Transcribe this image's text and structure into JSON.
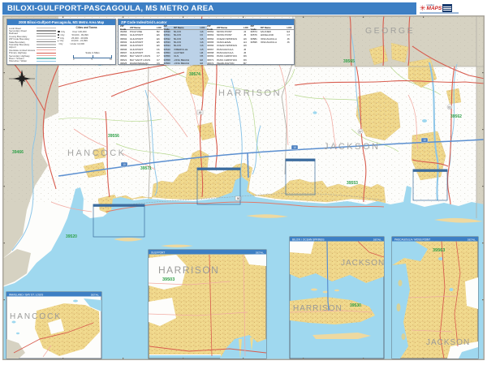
{
  "title_bar": {
    "title": "BILOXI-GULFPORT-PASCAGOULA, MS METRO AREA"
  },
  "logo": {
    "glyph": "✳",
    "name_top": "market",
    "name_main": "MAPS"
  },
  "colors": {
    "accent_blue": "#3d7fc4",
    "outside_area": "#d6d2c2",
    "metro_white": "#fdfdfb",
    "urban": "#f1da8e",
    "water": "#9fd8ef",
    "road_red": "#d85c4e",
    "zip_green": "#2fa048",
    "county_gray": "#9b9b99",
    "table_highlight": "#bcd2e8"
  },
  "legend": {
    "header": "2008 Biloxi-Gulfport-Pascagoula, MS Metro Area Map",
    "columns_title": "Cities and Towns",
    "items": [
      {
        "label": "Local Road",
        "color": "#b9b9b9"
      },
      {
        "label": "Secondary Road",
        "color": "#9a9a9a"
      },
      {
        "label": "Railroad",
        "color": "#8a8a8a"
      },
      {
        "label": "County Boundary",
        "color": "#9a9a9a"
      },
      {
        "label": "ZIP Code Boundary",
        "color": "#c0c0c0"
      },
      {
        "label": "State Boundary",
        "color": "#8a8a8a"
      },
      {
        "label": "Township Boundary",
        "color": "#c7c7c7"
      },
      {
        "label": "Airport",
        "color": "#a5a5a5"
      },
      {
        "label": "Interstate Limited Access",
        "color": "#f2aca4"
      },
      {
        "label": "Primary Highway",
        "color": "#d85c4e"
      },
      {
        "label": "Secondary Highway",
        "color": "#f2aca4"
      },
      {
        "label": "River / Stream",
        "color": "#7fc9c0"
      },
      {
        "label": "Shoreline / Water",
        "color": "#8ec6e8"
      }
    ],
    "city_rows": [
      {
        "city": "City",
        "range": "Over 100,000"
      },
      {
        "city": "City",
        "range": "50,000 - 99,999"
      },
      {
        "city": "City",
        "range": "25,000 - 49,999"
      },
      {
        "city": "City",
        "range": "10,000 - 24,999"
      },
      {
        "city": "City",
        "range": "Under 10,000"
      }
    ],
    "scale_title": "Scale in Miles",
    "scale_ticks": [
      "0",
      "5",
      "10"
    ]
  },
  "zip_table": {
    "header": "ZIP Code Index/Grid Locator",
    "col_headers": [
      "ZIP Code",
      "ZIP Name",
      "LOC"
    ],
    "columns": [
      [
        {
          "zip": "39466",
          "name": "PICAYUNE",
          "loc": "B2"
        },
        {
          "zip": "39501",
          "name": "GULFPORT",
          "loc": "E6"
        },
        {
          "zip": "39502",
          "name": "GULFPORT",
          "loc": "E6"
        },
        {
          "zip": "39503",
          "name": "GULFPORT",
          "loc": "E5"
        },
        {
          "zip": "39505",
          "name": "GULFPORT",
          "loc": "E6"
        },
        {
          "zip": "39506",
          "name": "GULFPORT",
          "loc": "F6"
        },
        {
          "zip": "39507",
          "name": "GULFPORT",
          "loc": "F6"
        },
        {
          "zip": "39520",
          "name": "BAY SAINT LOUIS",
          "loc": "C7"
        },
        {
          "zip": "39521",
          "name": "BAY SAINT LOUIS",
          "loc": "C7"
        },
        {
          "zip": "39525",
          "name": "DIAMONDHEAD",
          "loc": "C6"
        }
      ],
      [
        {
          "zip": "39530",
          "name": "BILOXI",
          "loc": "G6"
        },
        {
          "zip": "39531",
          "name": "BILOXI",
          "loc": "F6"
        },
        {
          "zip": "39532",
          "name": "BILOXI",
          "loc": "G5"
        },
        {
          "zip": "39533",
          "name": "BILOXI",
          "loc": "G6"
        },
        {
          "zip": "39534",
          "name": "BILOXI",
          "loc": "G6"
        },
        {
          "zip": "39540",
          "name": "D'IBERVILLE",
          "loc": "G5"
        },
        {
          "zip": "39553",
          "name": "GAUTIER",
          "loc": "H6"
        },
        {
          "zip": "39556",
          "name": "KILN",
          "loc": "D5"
        },
        {
          "zip": "39558",
          "name": "LONG BEACH",
          "loc": "E6"
        },
        {
          "zip": "39560",
          "name": "LONG BEACH",
          "loc": "E6"
        }
      ],
      [
        {
          "zip": "39562",
          "name": "MOSS POINT",
          "loc": "J4"
        },
        {
          "zip": "39563",
          "name": "MOSS POINT",
          "loc": "J5"
        },
        {
          "zip": "39564",
          "name": "OCEAN SPRINGS",
          "loc": "H6"
        },
        {
          "zip": "39565",
          "name": "VANCLEAVE",
          "loc": "H4"
        },
        {
          "zip": "39566",
          "name": "OCEAN SPRINGS",
          "loc": "H6"
        },
        {
          "zip": "39567",
          "name": "PASCAGOULA",
          "loc": "J6"
        },
        {
          "zip": "39568",
          "name": "PASCAGOULA",
          "loc": "J6"
        },
        {
          "zip": "39569",
          "name": "PASS CHRISTIAN",
          "loc": "D6"
        },
        {
          "zip": "39571",
          "name": "PASS CHRISTIAN",
          "loc": "D6"
        },
        {
          "zip": "39572",
          "name": "PEARLINGTON",
          "loc": "B7"
        }
      ],
      [
        {
          "zip": "39574",
          "name": "SAUCIER",
          "loc": "E4"
        },
        {
          "zip": "39576",
          "name": "WAVELAND",
          "loc": "C7"
        },
        {
          "zip": "39581",
          "name": "PASCAGOULA",
          "loc": "J6"
        },
        {
          "zip": "39595",
          "name": "PASCAGOULA",
          "loc": "J6"
        }
      ]
    ]
  },
  "map": {
    "counties": [
      {
        "name": "GEORGE"
      },
      {
        "name": "HANCOCK"
      },
      {
        "name": "HARRISON"
      },
      {
        "name": "JACKSON"
      }
    ],
    "zip_labels": [
      {
        "zip": "39466"
      },
      {
        "zip": "39556"
      },
      {
        "zip": "39574"
      },
      {
        "zip": "39571"
      },
      {
        "zip": "39565"
      },
      {
        "zip": "39562"
      },
      {
        "zip": "39553"
      },
      {
        "zip": "39520"
      }
    ],
    "shields": [
      {
        "label": "10"
      },
      {
        "label": "10"
      },
      {
        "label": "10"
      },
      {
        "label": "49"
      },
      {
        "label": "90"
      },
      {
        "label": "57"
      },
      {
        "label": "63"
      }
    ]
  },
  "insets": [
    {
      "title": "WAVELAND / BAY ST. LOUIS",
      "right_label": "DETAIL",
      "county": "HANCOCK"
    },
    {
      "title": "GULFPORT",
      "right_label": "DETAIL",
      "county": "HARRISON",
      "zip": "39503"
    },
    {
      "title": "BILOXI / OCEAN SPRINGS",
      "right_label": "DETAIL",
      "county_top": "JACKSON",
      "county_bottom": "HARRISON",
      "zip": "39530"
    },
    {
      "title": "PASCAGOULA / MOSS POINT",
      "right_label": "DETAIL",
      "county": "JACKSON",
      "zip": "39563"
    }
  ]
}
